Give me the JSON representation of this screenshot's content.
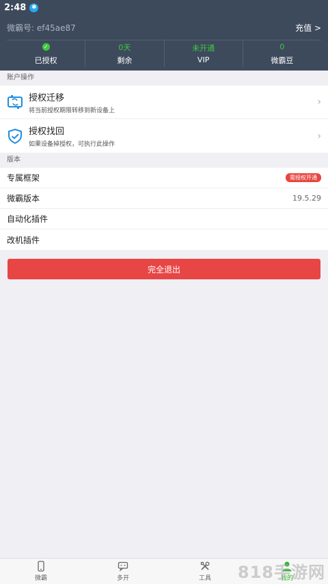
{
  "status_bar": {
    "time": "2:48"
  },
  "account": {
    "id_text": "微霸号: ef45ae87",
    "recharge_label": "充值 >"
  },
  "stats": [
    {
      "value": "",
      "label": "已授权",
      "icon": "check-circle"
    },
    {
      "value": "0天",
      "label": "剩余"
    },
    {
      "value": "未开通",
      "label": "VIP"
    },
    {
      "value": "0",
      "label": "微霸豆"
    }
  ],
  "sections": {
    "account_ops": "账户操作",
    "version": "版本"
  },
  "account_ops": [
    {
      "title": "授权迁移",
      "desc": "将当前授权期限转移到新设备上",
      "icon": "transfer-icon"
    },
    {
      "title": "授权找回",
      "desc": "如果设备掉授权，可执行此操作",
      "icon": "shield-check-icon"
    }
  ],
  "version_items": [
    {
      "label": "专属框架",
      "badge": "需授权开通"
    },
    {
      "label": "微霸版本",
      "value": "19.5.29"
    },
    {
      "label": "自动化插件"
    },
    {
      "label": "改机插件"
    }
  ],
  "logout_label": "完全退出",
  "tabs": [
    {
      "label": "微霸",
      "icon": "phone-icon"
    },
    {
      "label": "多开",
      "icon": "chat-icon"
    },
    {
      "label": "工具",
      "icon": "tools-icon"
    },
    {
      "label": "我的",
      "icon": "person-icon",
      "active": true
    }
  ],
  "watermark": "818手游网",
  "colors": {
    "header": "#3d4a5c",
    "accent_green": "#3ec93e",
    "danger": "#e84545",
    "icon_blue": "#1e8ee0"
  }
}
